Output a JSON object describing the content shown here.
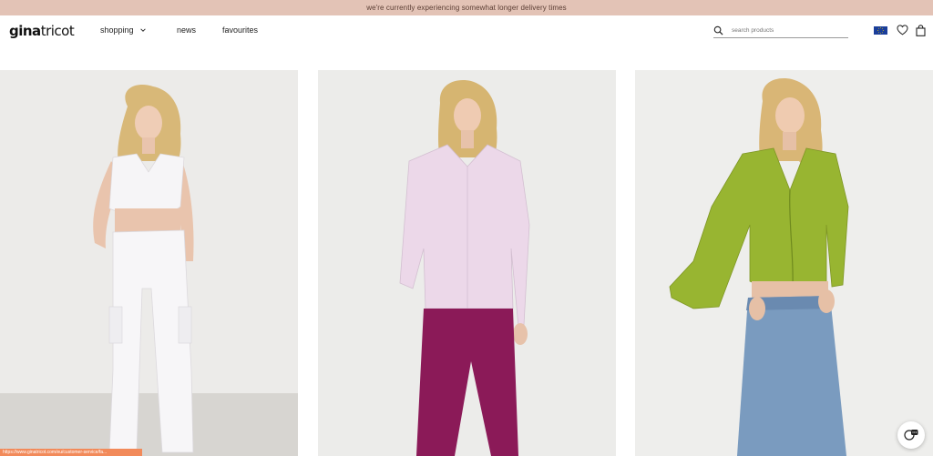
{
  "banner": {
    "text": "we're currently experiencing somewhat longer delivery times"
  },
  "header": {
    "logo_bold": "gina",
    "logo_light": "tricot",
    "nav": [
      {
        "label": "shopping",
        "has_dropdown": true,
        "icon": "chevron-down-icon"
      },
      {
        "label": "news"
      },
      {
        "label": "favourites"
      }
    ],
    "search": {
      "placeholder": "search products",
      "icon": "search-icon"
    },
    "icons": [
      "eu-flag-icon",
      "heart-icon",
      "bag-icon"
    ]
  },
  "products": [
    {
      "image": "model in white cropped vest and white cargo trousers",
      "bg": "#ecebe9"
    },
    {
      "image": "model in lilac shirt and magenta trousers",
      "bg": "#ececea"
    },
    {
      "image": "model in green ruched top and denim skirt",
      "bg": "#eeeeec"
    }
  ],
  "status_bar": {
    "url": "https://www.ginatricot.com/eu/customer-service/fa..."
  },
  "chat": {
    "icon": "chat-bubble-icon"
  },
  "colors": {
    "banner_bg": "#e3c3b6",
    "banner_text": "#5a3d33",
    "status_bar_bg": "#f28a5a"
  }
}
